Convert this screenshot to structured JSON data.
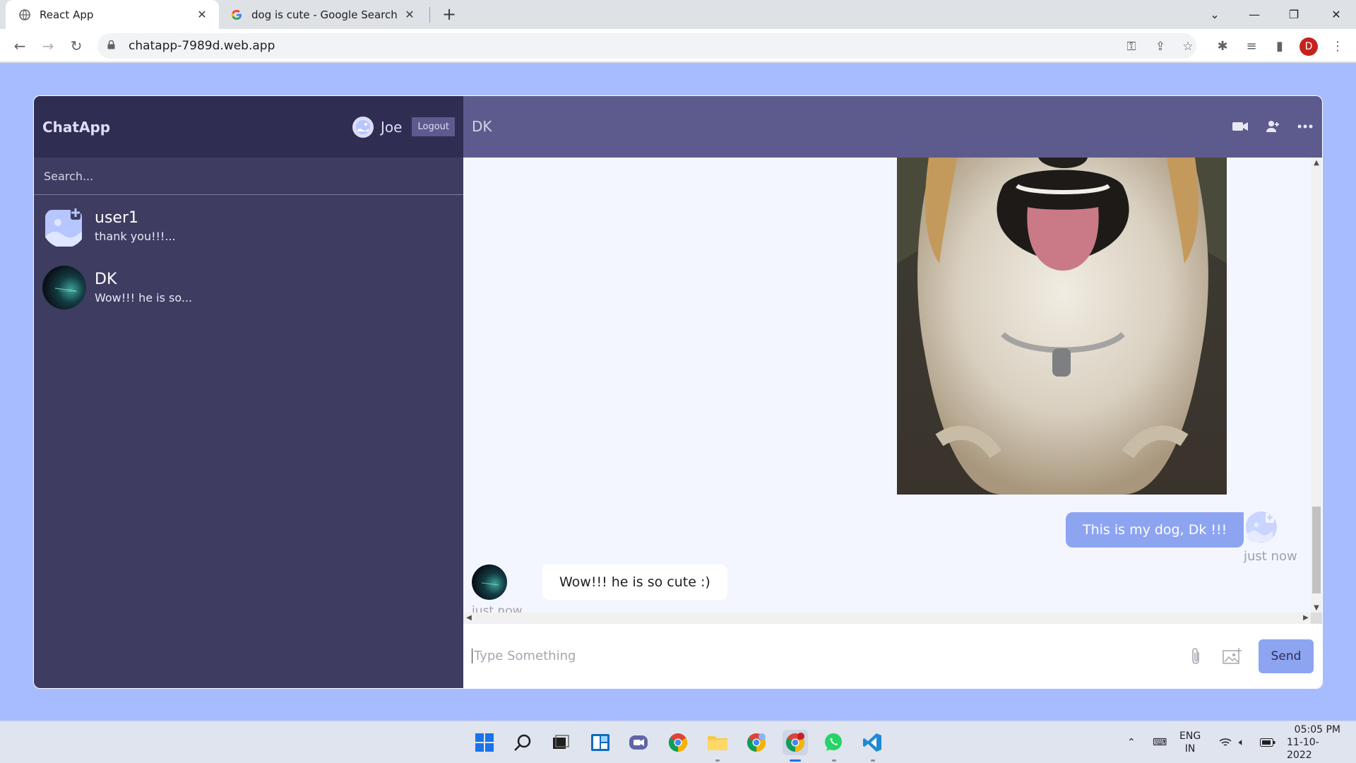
{
  "browser": {
    "tabs": [
      {
        "title": "React App",
        "active": true
      },
      {
        "title": "dog is cute - Google Search",
        "active": false
      }
    ],
    "url": "chatapp-7989d.web.app",
    "profile_initial": "D"
  },
  "app": {
    "logo": "ChatApp",
    "current_user": "Joe",
    "logout_label": "Logout",
    "search_placeholder": "Search...",
    "chats": [
      {
        "name": "user1",
        "last_message": "thank you!!!..."
      },
      {
        "name": "DK",
        "last_message": "Wow!!! he is so..."
      }
    ],
    "chat_header": {
      "name": "DK",
      "icons": [
        "video-camera-icon",
        "add-user-icon",
        "more-icon"
      ]
    },
    "messages": [
      {
        "owner": true,
        "type": "image",
        "alt": "dog"
      },
      {
        "owner": true,
        "text": "This is my dog, Dk !!!",
        "time": "just now"
      },
      {
        "owner": false,
        "text": "Wow!!! he is so cute :)",
        "time": "just now"
      }
    ],
    "input": {
      "placeholder": "Type Something",
      "value": ""
    },
    "send_label": "Send",
    "colors": {
      "sidebar": "#3e3c61",
      "sidebar_nav": "#2f2d52",
      "chat_header": "#5d5b8d",
      "messages_bg": "#f4f6ff",
      "accent": "#8da4f1",
      "page_bg": "#a7bcff"
    }
  },
  "taskbar": {
    "language": "ENG",
    "region": "IN",
    "time": "05:05 PM",
    "date": "11-10-2022"
  }
}
